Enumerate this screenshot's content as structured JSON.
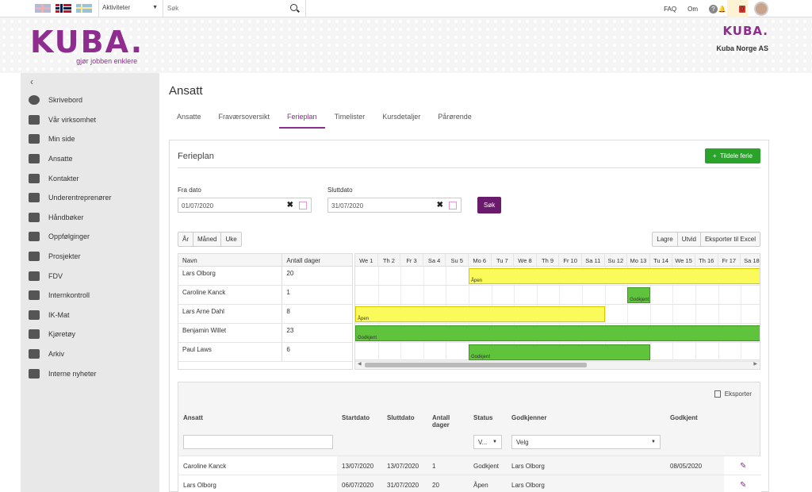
{
  "topbar": {
    "flags": [
      "uk-flag",
      "norway-flag",
      "sweden-flag"
    ],
    "activity_select": "Aktiviteter",
    "search_placeholder": "Søk",
    "faq": "FAQ",
    "about": "Om",
    "help": "?",
    "notification_count": "0"
  },
  "header": {
    "logo": "KUBA.",
    "tagline": "gjør jobben enklere",
    "small_logo": "KUBA.",
    "company": "Kuba Norge AS"
  },
  "sidebar": {
    "collapse": "‹",
    "items": [
      {
        "label": "Skrivebord",
        "icon": "dashboard-icon"
      },
      {
        "label": "Vår virksomhet",
        "icon": "briefcase-icon"
      },
      {
        "label": "Min side",
        "icon": "id-card-icon"
      },
      {
        "label": "Ansatte",
        "icon": "users-icon"
      },
      {
        "label": "Kontakter",
        "icon": "contact-card-icon"
      },
      {
        "label": "Underentreprenører",
        "icon": "person-icon"
      },
      {
        "label": "Håndbøker",
        "icon": "book-icon"
      },
      {
        "label": "Oppfølginger",
        "icon": "calendar-icon"
      },
      {
        "label": "Prosjekter",
        "icon": "pencil-doc-icon"
      },
      {
        "label": "FDV",
        "icon": "building-icon"
      },
      {
        "label": "Internkontroll",
        "icon": "clipboard-icon"
      },
      {
        "label": "IK-Mat",
        "icon": "trophy-icon"
      },
      {
        "label": "Kjøretøy",
        "icon": "truck-icon"
      },
      {
        "label": "Arkiv",
        "icon": "archive-icon"
      },
      {
        "label": "Interne nyheter",
        "icon": "newspaper-icon"
      }
    ]
  },
  "main": {
    "title": "Ansatt",
    "tabs": [
      "Ansatte",
      "Fraværsoversikt",
      "Ferieplan",
      "Timelister",
      "Kursdetaljer",
      "Pårørende"
    ],
    "active_tab": "Ferieplan"
  },
  "panel": {
    "title": "Ferieplan",
    "assign_button": "Tildele ferie",
    "from_label": "Fra dato",
    "from_value": "01/07/2020",
    "to_label": "Sluttdato",
    "to_value": "31/07/2020",
    "search_button": "Søk",
    "view_buttons": [
      "År",
      "Måned",
      "Uke"
    ],
    "action_buttons": [
      "Lagre",
      "Utvid",
      "Eksporter til Excel"
    ]
  },
  "gantt": {
    "col_name": "Navn",
    "col_days": "Antall dager",
    "days": [
      "We 1",
      "Th 2",
      "Fr 3",
      "Sa 4",
      "Su 5",
      "Mo 6",
      "Tu 7",
      "We 8",
      "Th 9",
      "Fr 10",
      "Sa 11",
      "Su 12",
      "Mo 13",
      "Tu 14",
      "We 15",
      "Th 16",
      "Fr 17",
      "Sa 18"
    ],
    "rows": [
      {
        "name": "Lars Olborg",
        "days": "20",
        "start": 6,
        "end": 31,
        "status": "Åpen",
        "color": "yellow"
      },
      {
        "name": "Caroline Kanck",
        "days": "1",
        "start": 13,
        "end": 13,
        "status": "Godkjent",
        "color": "green"
      },
      {
        "name": "Lars Arne Dahl",
        "days": "8",
        "start": 1,
        "end": 11,
        "status": "Åpen",
        "color": "yellow"
      },
      {
        "name": "Benjamin Willet",
        "days": "23",
        "start": 1,
        "end": 31,
        "status": "Godkjent",
        "color": "green"
      },
      {
        "name": "Paul Laws",
        "days": "6",
        "start": 6,
        "end": 13,
        "status": "Godkjent",
        "color": "green"
      }
    ]
  },
  "table": {
    "export": "Eksporter",
    "headers": [
      "Ansatt",
      "Startdato",
      "Sluttdato",
      "Antall dager",
      "Status",
      "Godkjenner",
      "Godkjent"
    ],
    "status_filter": "V...",
    "approver_filter": "Velg",
    "rows": [
      {
        "ansatt": "Caroline Kanck",
        "start": "13/07/2020",
        "slutt": "13/07/2020",
        "dager": "1",
        "status": "Godkjent",
        "godkjenner": "Lars Olborg",
        "godkjent": "08/05/2020"
      },
      {
        "ansatt": "Lars Olborg",
        "start": "06/07/2020",
        "slutt": "31/07/2020",
        "dager": "20",
        "status": "Åpen",
        "godkjenner": "Lars Olborg",
        "godkjent": ""
      }
    ]
  },
  "colors": {
    "brand": "#8e2d8f",
    "green": "#2aa32a",
    "yellow_bar": "#fafa5a",
    "green_bar": "#5fc43c"
  }
}
